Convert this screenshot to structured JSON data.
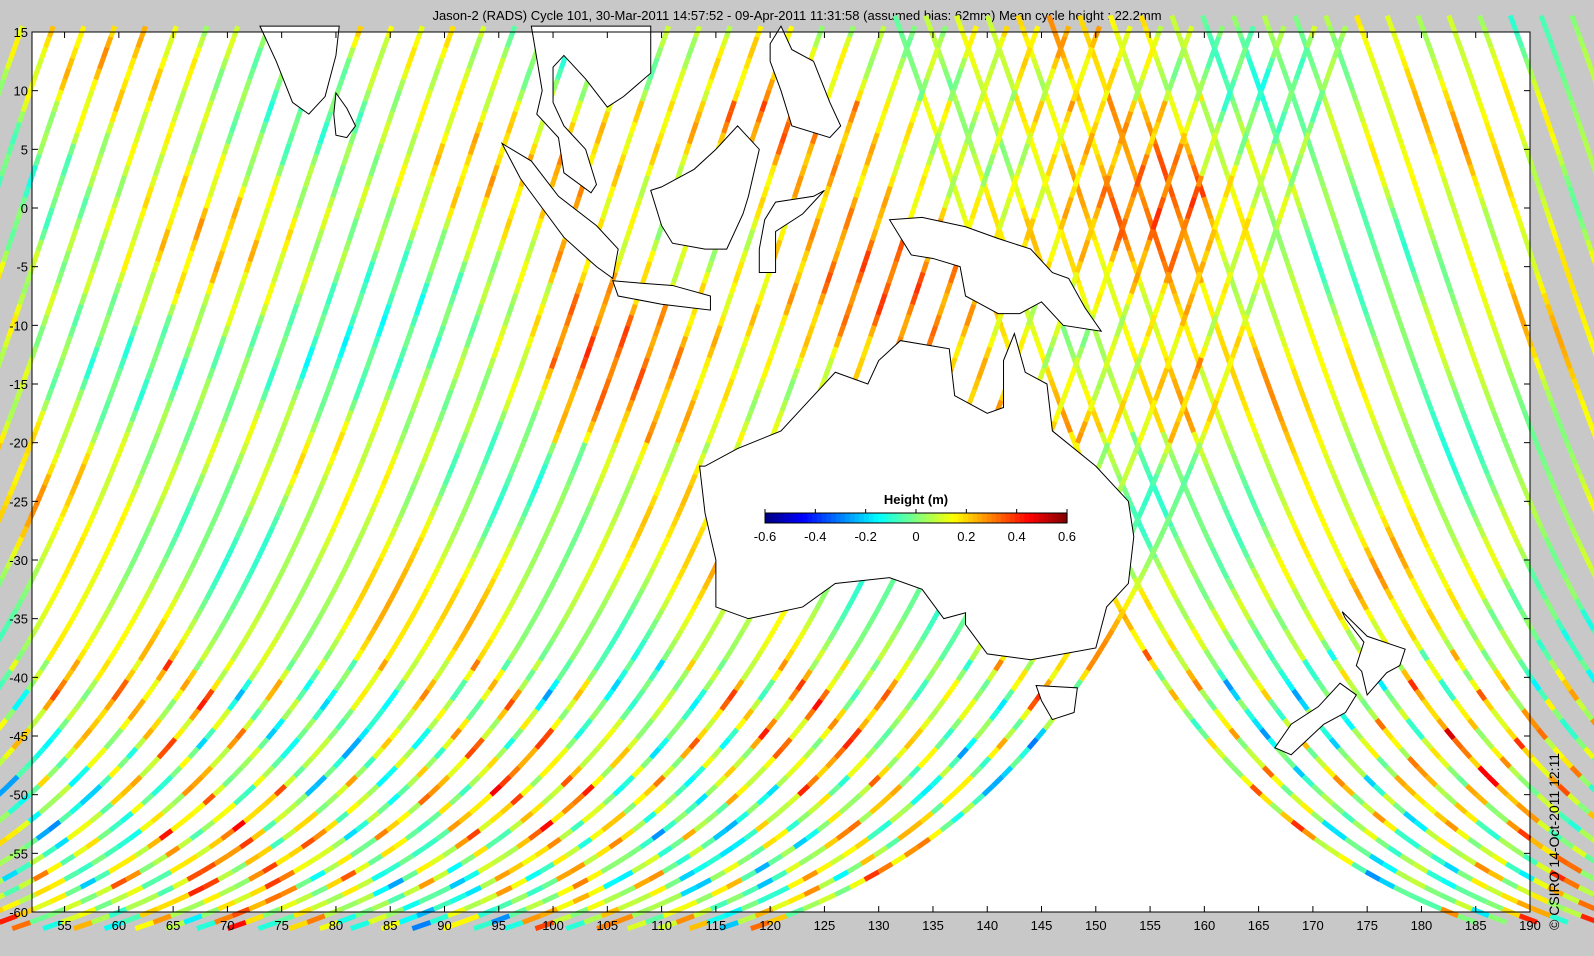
{
  "chart_data": {
    "type": "map",
    "title": "Jason-2 (RADS) Cycle 101, 30-Mar-2011 14:57:52 - 09-Apr-2011 11:31:58 (assumed bias: 62mm)  Mean cycle height : 22.2mm",
    "xlim": [
      52,
      190
    ],
    "ylim": [
      -60,
      15
    ],
    "xticks": [
      55,
      60,
      65,
      70,
      75,
      80,
      85,
      90,
      95,
      100,
      105,
      110,
      115,
      120,
      125,
      130,
      135,
      140,
      145,
      150,
      155,
      160,
      165,
      170,
      175,
      180,
      185,
      190
    ],
    "yticks": [
      15,
      10,
      5,
      0,
      -5,
      -10,
      -15,
      -20,
      -25,
      -30,
      -35,
      -40,
      -45,
      -50,
      -55,
      -60
    ],
    "colorbar": {
      "label": "Height (m)",
      "range": [
        -0.6,
        0.6
      ],
      "ticks": [
        "-0.6",
        "-0.4",
        "-0.2",
        "0",
        "0.2",
        "0.4",
        "0.6"
      ],
      "colormap": "jet"
    },
    "track_spacing_deg": 2.835,
    "inclination_deg": 66
  },
  "copyright": "© CSIRO 14-Oct-2011 12:11"
}
